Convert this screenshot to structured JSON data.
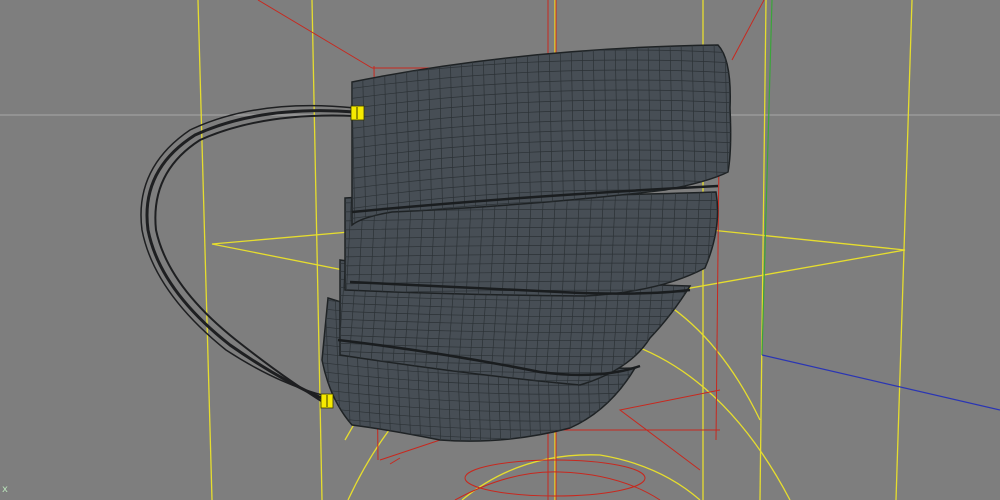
{
  "viewport": {
    "background": "#7e7e7e",
    "axis_label": "x"
  },
  "colors": {
    "mesh_fill": "#474e55",
    "mesh_line": "#2c3236",
    "strap": "#1e1f21",
    "handle_yellow": "#f6ea00",
    "guide_yellow": "#e6dd2e",
    "bbox_red": "#c8281e",
    "horizon": "#a8a8a8",
    "axis_green": "#3aa53a",
    "axis_blue": "#2a35b4"
  },
  "objects": [
    {
      "name": "face-mask-mesh",
      "type": "polygon mesh"
    },
    {
      "name": "ear-loop-strap",
      "type": "spline"
    }
  ]
}
